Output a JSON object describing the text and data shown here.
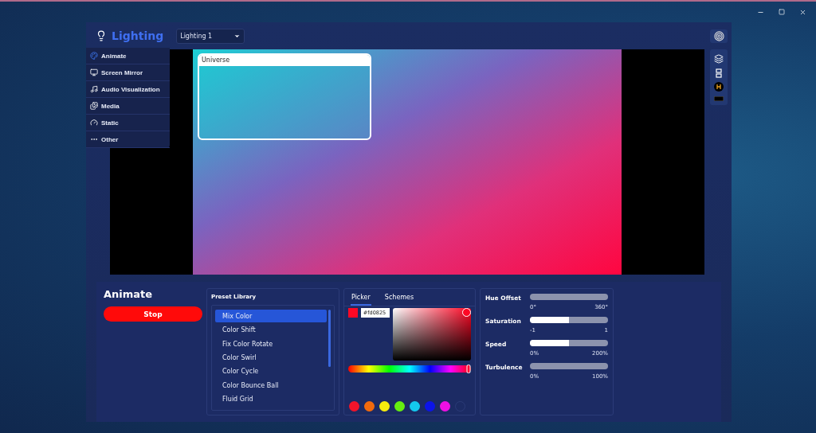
{
  "header": {
    "title": "Lighting",
    "dropdown": "Lighting 1"
  },
  "menu": [
    {
      "label": "Animate",
      "selected": true
    },
    {
      "label": "Screen Mirror",
      "selected": false
    },
    {
      "label": "Audio Visualization",
      "selected": false
    },
    {
      "label": "Media",
      "selected": false
    },
    {
      "label": "Static",
      "selected": false
    },
    {
      "label": "Other",
      "selected": false
    }
  ],
  "stage": {
    "zone": "Universe"
  },
  "effect": {
    "title": "Animate",
    "button": "Stop"
  },
  "preset_library": {
    "title": "Preset Library",
    "items": [
      {
        "label": "Mix Color",
        "selected": true
      },
      {
        "label": "Color Shift",
        "selected": false
      },
      {
        "label": "Fix Color Rotate",
        "selected": false
      },
      {
        "label": "Color Swirl",
        "selected": false
      },
      {
        "label": "Color Cycle",
        "selected": false
      },
      {
        "label": "Color Bounce Ball",
        "selected": false
      },
      {
        "label": "Fluid Grid",
        "selected": false
      }
    ]
  },
  "color_picker": {
    "tabs": [
      {
        "label": "Picker",
        "selected": true
      },
      {
        "label": "Schemes",
        "selected": false
      }
    ],
    "hex": "#fd0825",
    "color": "#fd0825",
    "hue": {
      "level": 1
    },
    "swatches": [
      {
        "kind": "color",
        "color": "#f0142a"
      },
      {
        "kind": "color",
        "color": "#f26a0c"
      },
      {
        "kind": "color",
        "color": "#f6ec0e"
      },
      {
        "kind": "color",
        "color": "#66ee10"
      },
      {
        "kind": "color",
        "color": "#14c8ee"
      },
      {
        "kind": "color",
        "color": "#0c14e8"
      },
      {
        "kind": "color",
        "color": "#ee10e4"
      },
      {
        "kind": "empty"
      }
    ]
  },
  "sliders": [
    {
      "label": "Hue Offset",
      "level": 0,
      "min": "0°",
      "max": "360°"
    },
    {
      "label": "Saturation",
      "level": 0.5,
      "min": "-1",
      "max": "1"
    },
    {
      "label": "Speed",
      "level": 0.5,
      "min": "0%",
      "max": "200%"
    },
    {
      "label": "Turbulence",
      "level": 0,
      "min": "0%",
      "max": "100%"
    }
  ]
}
